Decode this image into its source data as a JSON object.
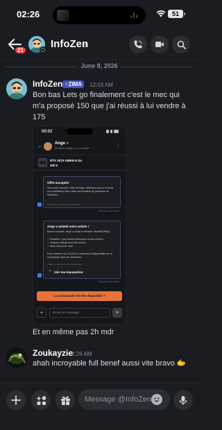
{
  "status_bar": {
    "time": "02:26",
    "battery": "51"
  },
  "header": {
    "title": "InfoZen",
    "unread_badge": "21"
  },
  "chat": {
    "date_divider": "June 8, 2026",
    "messages": [
      {
        "author": "InfoZen",
        "tag": "ZIMA",
        "timestamp": "12:03 AM",
        "text": "Bon bas Lets go finalement c'est le mec qui m'a proposé 150 que j'ai réussi à lui vendre à 175",
        "attachment": {
          "status_time": "00:02",
          "contact_name": "Ange",
          "contact_sub": "Dernière activité il y a 2 minutes",
          "product_name": "RTX 2070 OMEN 8 Go",
          "product_price": "200 €",
          "card1_title": "Offre acceptée",
          "card1_body": "Vous avez accepté l'offre de Ange. Attendez-vous à recevoir une notification dans cette conversation du paiement de l'acheteur.",
          "card1_small": "L'annulera » 48 heures maxi passée",
          "card1_meta": "Message automatique",
          "card2_title": "Ange a acheté votre article !",
          "card2_body1": "Bonne nouvelle, Ange a choisi la livraison Mondial Relay.",
          "card2_bullet1": "✓ Nouveau : plus besoin d'imprimer ta bon d'envoi",
          "card2_bullet2": "✓ Horaires élargis avec les lockers",
          "card2_bullet3": "✓ Sans frais pour vous",
          "card2_body2": "Pour recevoir vos 175,00 €, confirmez la disponibilité de sa commande dans les 48 heures.",
          "card2_small": "Passé ce délai, la vente sera annulée.",
          "card2_button": "Voir ma transaction",
          "card2_meta": "Message automatique",
          "cta": "La commande est-elle disponible ?",
          "input_placeholder": "Écrire un message..."
        }
      },
      {
        "text": "Et en même pas 2h mdr"
      },
      {
        "author": "Zoukayzie",
        "timestamp": "2:26 AM",
        "text": "ahah incroyable full benef aussi vite bravo 🫱"
      }
    ]
  },
  "composer": {
    "placeholder": "Message @InfoZen"
  },
  "colors": {
    "accent": "#5865f2",
    "badge": "#f23f43",
    "cta": "#e8733a",
    "background": "#1b1c22"
  }
}
